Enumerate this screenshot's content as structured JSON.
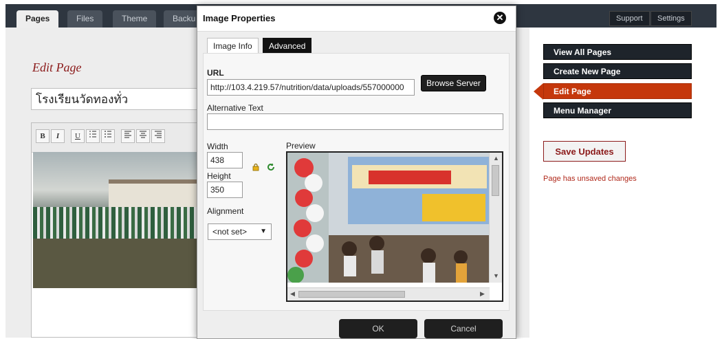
{
  "top_tabs": [
    {
      "label": "Pages",
      "active": true
    },
    {
      "label": "Files",
      "active": false
    },
    {
      "label": "Theme",
      "active": false
    },
    {
      "label": "Backu",
      "active": false
    }
  ],
  "top_links": {
    "support": "Support",
    "settings": "Settings"
  },
  "editor": {
    "heading": "Edit Page",
    "title_value": "โรงเรียนวัดทองทั่ว",
    "toolbar": [
      "B",
      "I",
      "U",
      "ol",
      "ul",
      "align-left",
      "align-center",
      "align-right"
    ]
  },
  "sidebar": {
    "items": [
      {
        "label": "View All Pages",
        "active": false
      },
      {
        "label": "Create New Page",
        "active": false
      },
      {
        "label": "Edit Page",
        "active": true
      },
      {
        "label": "Menu Manager",
        "active": false
      }
    ],
    "save_label": "Save Updates",
    "unsaved_text": "Page has unsaved changes"
  },
  "dialog": {
    "title": "Image Properties",
    "tabs": [
      {
        "label": "Image Info",
        "active": true
      },
      {
        "label": "Advanced",
        "active": false
      }
    ],
    "url_label": "URL",
    "url_value": "http://103.4.219.57/nutrition/data/uploads/557000000",
    "browse_label": "Browse Server",
    "alt_label": "Alternative Text",
    "alt_value": "",
    "width_label": "Width",
    "width_value": "438",
    "height_label": "Height",
    "height_value": "350",
    "alignment_label": "Alignment",
    "alignment_value": "<not set>",
    "preview_label": "Preview",
    "ok_label": "OK",
    "cancel_label": "Cancel"
  },
  "colors": {
    "accent": "#c5380c",
    "dark": "#1e242b",
    "heading": "#8b1a1a"
  }
}
